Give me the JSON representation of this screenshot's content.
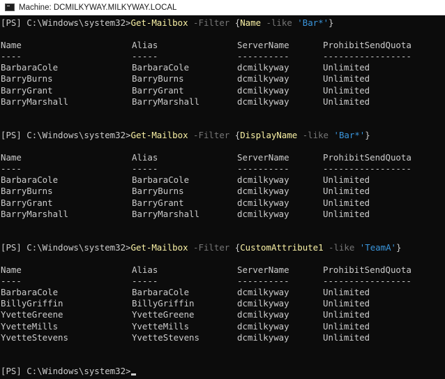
{
  "window": {
    "title": "Machine: DCMILKYWAY.MILKYWAY.LOCAL"
  },
  "prompt": "[PS] C:\\Windows\\system32>",
  "blocks": [
    {
      "cmdlet": "Get-Mailbox",
      "param": "-Filter",
      "open_brace": "{",
      "property": "Name",
      "operator": "-like",
      "value": "'Bar*'",
      "close_brace": "}",
      "headers": [
        "Name",
        "Alias",
        "ServerName",
        "ProhibitSendQuota"
      ],
      "dashes": [
        "----",
        "-----",
        "----------",
        "-----------------"
      ],
      "rows": [
        [
          "BarbaraCole",
          "BarbaraCole",
          "dcmilkyway",
          "Unlimited"
        ],
        [
          "BarryBurns",
          "BarryBurns",
          "dcmilkyway",
          "Unlimited"
        ],
        [
          "BarryGrant",
          "BarryGrant",
          "dcmilkyway",
          "Unlimited"
        ],
        [
          "BarryMarshall",
          "BarryMarshall",
          "dcmilkyway",
          "Unlimited"
        ]
      ]
    },
    {
      "cmdlet": "Get-Mailbox",
      "param": "-Filter",
      "open_brace": "{",
      "property": "DisplayName",
      "operator": "-like",
      "value": "'Bar*'",
      "close_brace": "}",
      "headers": [
        "Name",
        "Alias",
        "ServerName",
        "ProhibitSendQuota"
      ],
      "dashes": [
        "----",
        "-----",
        "----------",
        "-----------------"
      ],
      "rows": [
        [
          "BarbaraCole",
          "BarbaraCole",
          "dcmilkyway",
          "Unlimited"
        ],
        [
          "BarryBurns",
          "BarryBurns",
          "dcmilkyway",
          "Unlimited"
        ],
        [
          "BarryGrant",
          "BarryGrant",
          "dcmilkyway",
          "Unlimited"
        ],
        [
          "BarryMarshall",
          "BarryMarshall",
          "dcmilkyway",
          "Unlimited"
        ]
      ]
    },
    {
      "cmdlet": "Get-Mailbox",
      "param": "-Filter",
      "open_brace": "{",
      "property": "CustomAttribute1",
      "operator": "-like",
      "value": "'TeamA'",
      "close_brace": "}",
      "headers": [
        "Name",
        "Alias",
        "ServerName",
        "ProhibitSendQuota"
      ],
      "dashes": [
        "----",
        "-----",
        "----------",
        "-----------------"
      ],
      "rows": [
        [
          "BarbaraCole",
          "BarbaraCole",
          "dcmilkyway",
          "Unlimited"
        ],
        [
          "BillyGriffin",
          "BillyGriffin",
          "dcmilkyway",
          "Unlimited"
        ],
        [
          "YvetteGreene",
          "YvetteGreene",
          "dcmilkyway",
          "Unlimited"
        ],
        [
          "YvetteMills",
          "YvetteMills",
          "dcmilkyway",
          "Unlimited"
        ],
        [
          "YvetteStevens",
          "YvetteStevens",
          "dcmilkyway",
          "Unlimited"
        ]
      ]
    }
  ],
  "colors": {
    "background": "#0c0c0c",
    "foreground": "#cccccc",
    "cmdlet": "#f9f1a5",
    "parameter": "#767676",
    "string": "#3a96dd"
  },
  "icons": {
    "window": "console-window-icon"
  }
}
